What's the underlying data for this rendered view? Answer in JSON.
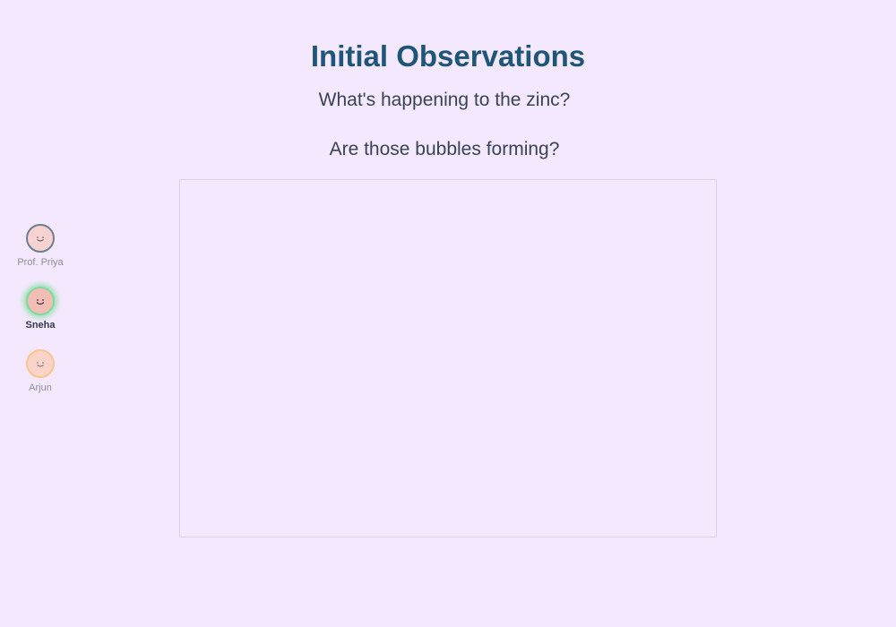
{
  "slide": {
    "title": "Initial Observations",
    "prompts": [
      "What's happening to the zinc?",
      "Are those bubbles forming?"
    ]
  },
  "participants": [
    {
      "name": "Prof. Priya",
      "icon": "smiley-face-icon",
      "face_color": "#f6d3d0",
      "ring_color": "#6f7e8f",
      "speaking": false
    },
    {
      "name": "Sneha",
      "icon": "smiley-face-icon",
      "face_color": "#f3bdb5",
      "ring_color": "#86d6a0",
      "speaking": true
    },
    {
      "name": "Arjun",
      "icon": "smiley-face-icon",
      "face_color": "#fad3c9",
      "ring_color": "#f7c58f",
      "speaking": false
    }
  ],
  "colors": {
    "background": "#f3e8fe",
    "title": "#1f5577",
    "body_text": "#3a4356",
    "stage_border": "#d6d3df",
    "speaking_glow": "#9be0b3"
  }
}
